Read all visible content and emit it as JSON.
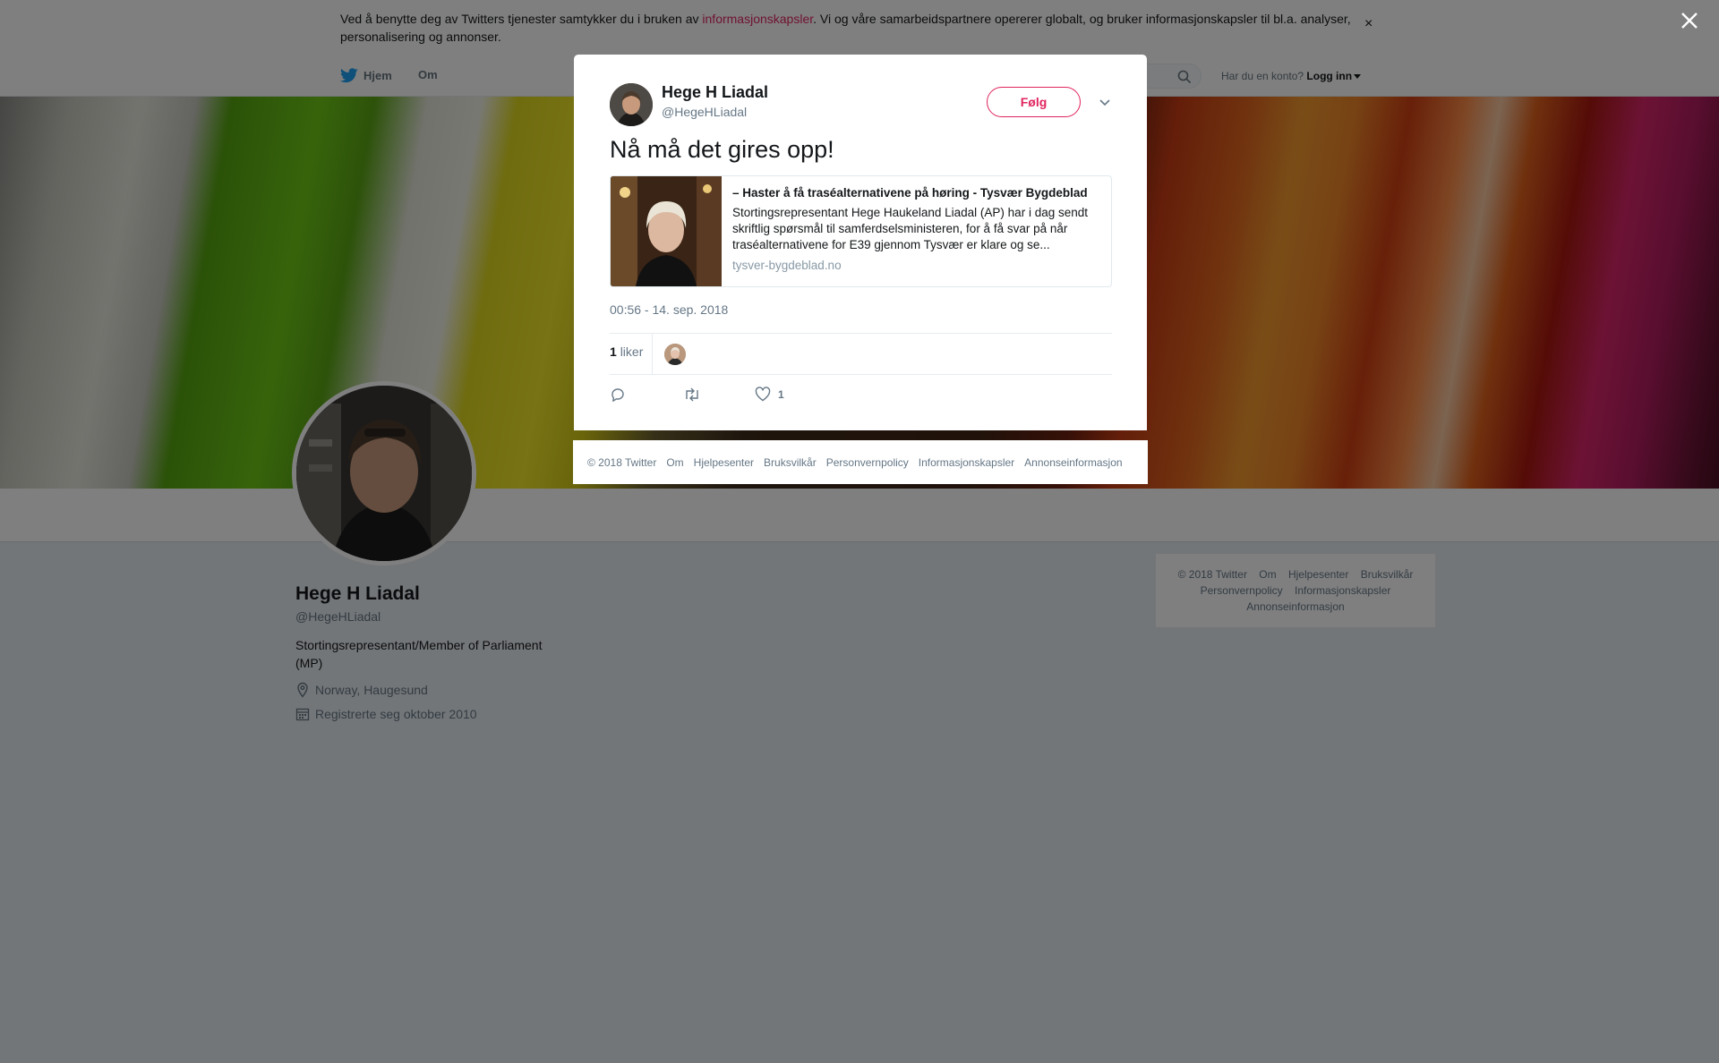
{
  "cookie_banner": {
    "text_before": "Ved å benytte deg av Twitters tjenester samtykker du i bruken av ",
    "link": "informasjonskapsler",
    "text_after": ". Vi og våre samarbeidspartnere opererer globalt, og bruker informasjonskapsler til bl.a. analyser, personalisering og annonser.",
    "close_glyph": "×"
  },
  "nav": {
    "home": "Hjem",
    "about": "Om",
    "login_prompt": "Har du en konto?",
    "login": "Logg inn"
  },
  "profile": {
    "name": "Hege H Liadal",
    "handle": "@HegeHLiadal",
    "bio": "Stortingsrepresentant/Member of Parliament (MP)",
    "location": "Norway, Haugesund",
    "joined": "Registrerte seg oktober 2010"
  },
  "side_footer": {
    "row1": [
      "© 2018 Twitter",
      "Om",
      "Hjelpesenter",
      "Bruksvilkår"
    ],
    "row2": [
      "Personvernpolicy",
      "Informasjonskapsler"
    ],
    "row3": [
      "Annonseinformasjon"
    ]
  },
  "tweet": {
    "name": "Hege H Liadal",
    "handle": "@HegeHLiadal",
    "follow_label": "Følg",
    "text": "Nå må det gires opp!",
    "card": {
      "title": "– Haster å få traséalternativene på høring - Tysvær Bygdeblad",
      "description": "Stortingsrepresentant Hege Haukeland Liadal (AP) har i dag sendt skriftlig spørsmål til samferdselsministeren, for å få svar på når traséalternativene for E39 gjennom Tysvær er klare og se...",
      "domain": "tysver-bygdeblad.no"
    },
    "timestamp": "00:56 - 14. sep. 2018",
    "likes_number": "1",
    "likes_word": "liker",
    "like_action_count": "1"
  },
  "modal_footer": [
    "© 2018 Twitter",
    "Om",
    "Hjelpesenter",
    "Bruksvilkår",
    "Personvernpolicy",
    "Informasjonskapsler",
    "Annonseinformasjon"
  ],
  "colors": {
    "accent": "#e0245e",
    "twitter_blue": "#1da1f2",
    "muted_text": "#657786",
    "page_bg": "#e6ecf0"
  },
  "icons": [
    "twitter-bird-icon",
    "search-icon",
    "caret-down-icon",
    "location-icon",
    "calendar-icon",
    "reply-icon",
    "retweet-icon",
    "heart-icon",
    "close-icon",
    "chevron-down-icon"
  ]
}
